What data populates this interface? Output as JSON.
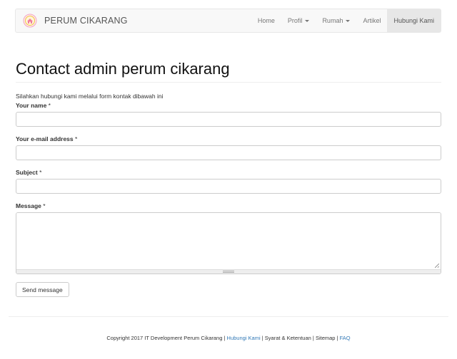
{
  "navbar": {
    "brand": "PERUM CIKARANG",
    "items": [
      {
        "label": "Home",
        "dropdown": false,
        "active": false
      },
      {
        "label": "Profil",
        "dropdown": true,
        "active": false
      },
      {
        "label": "Rumah",
        "dropdown": true,
        "active": false
      },
      {
        "label": "Artikel",
        "dropdown": false,
        "active": false
      },
      {
        "label": "Hubungi Kami",
        "dropdown": false,
        "active": true
      }
    ]
  },
  "page": {
    "title": "Contact admin perum cikarang",
    "intro": "Silahkan hubungi kami melalui form kontak dibawah ini"
  },
  "form": {
    "name_label": "Your name",
    "email_label": "Your e-mail address",
    "subject_label": "Subject",
    "message_label": "Message",
    "required_marker": "*",
    "name_value": "",
    "email_value": "",
    "subject_value": "",
    "message_value": "",
    "submit_label": "Send message"
  },
  "footer": {
    "copyright": "Copyright 2017 IT Development Perum Cikarang",
    "sep": "|",
    "link_contact": "Hubungi Kami",
    "terms": "Syarat & Ketentuan",
    "sitemap": "Sitemap",
    "link_faq": "FAQ"
  },
  "colors": {
    "link": "#337ab7",
    "navbar_bg": "#f8f8f8",
    "nav_active_bg": "#e7e7e7"
  },
  "icons": {
    "brand_logo": "house-logo-icon"
  }
}
